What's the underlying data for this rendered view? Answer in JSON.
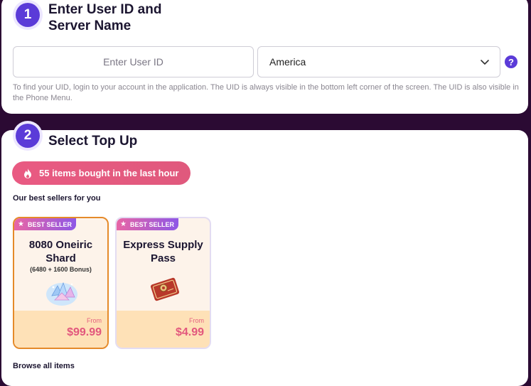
{
  "step1": {
    "number": "1",
    "title_line1": "Enter User ID and",
    "title_line2": "Server Name",
    "uid_placeholder": "Enter User ID",
    "uid_value": "",
    "server_selected": "America",
    "help_label": "?",
    "hint": "To find your UID, login to your account in the application. The UID is always visible in the bottom left corner of the screen. The UID is also visible in the Phone Menu."
  },
  "step2": {
    "number": "2",
    "title": "Select Top Up",
    "activity": "55 items bought in the last hour",
    "best_sellers_heading": "Our best sellers for you",
    "browse_all_heading": "Browse all items",
    "products": [
      {
        "badge": "BEST SELLER",
        "name": "8080 Oneiric Shard",
        "sub": "(6480 + 1600 Bonus)",
        "from_label": "From",
        "price": "$99.99",
        "icon": "oneiric-shard-icon",
        "selected": true
      },
      {
        "badge": "BEST SELLER",
        "name": "Express Supply Pass",
        "sub": "",
        "from_label": "From",
        "price": "$4.99",
        "icon": "supply-pass-icon",
        "selected": false
      }
    ]
  },
  "colors": {
    "background": "#2b0a33",
    "accent": "#5b3bd8",
    "pink": "#e2577d",
    "selected_border": "#e58a2a",
    "price_area": "#fee1b7"
  }
}
